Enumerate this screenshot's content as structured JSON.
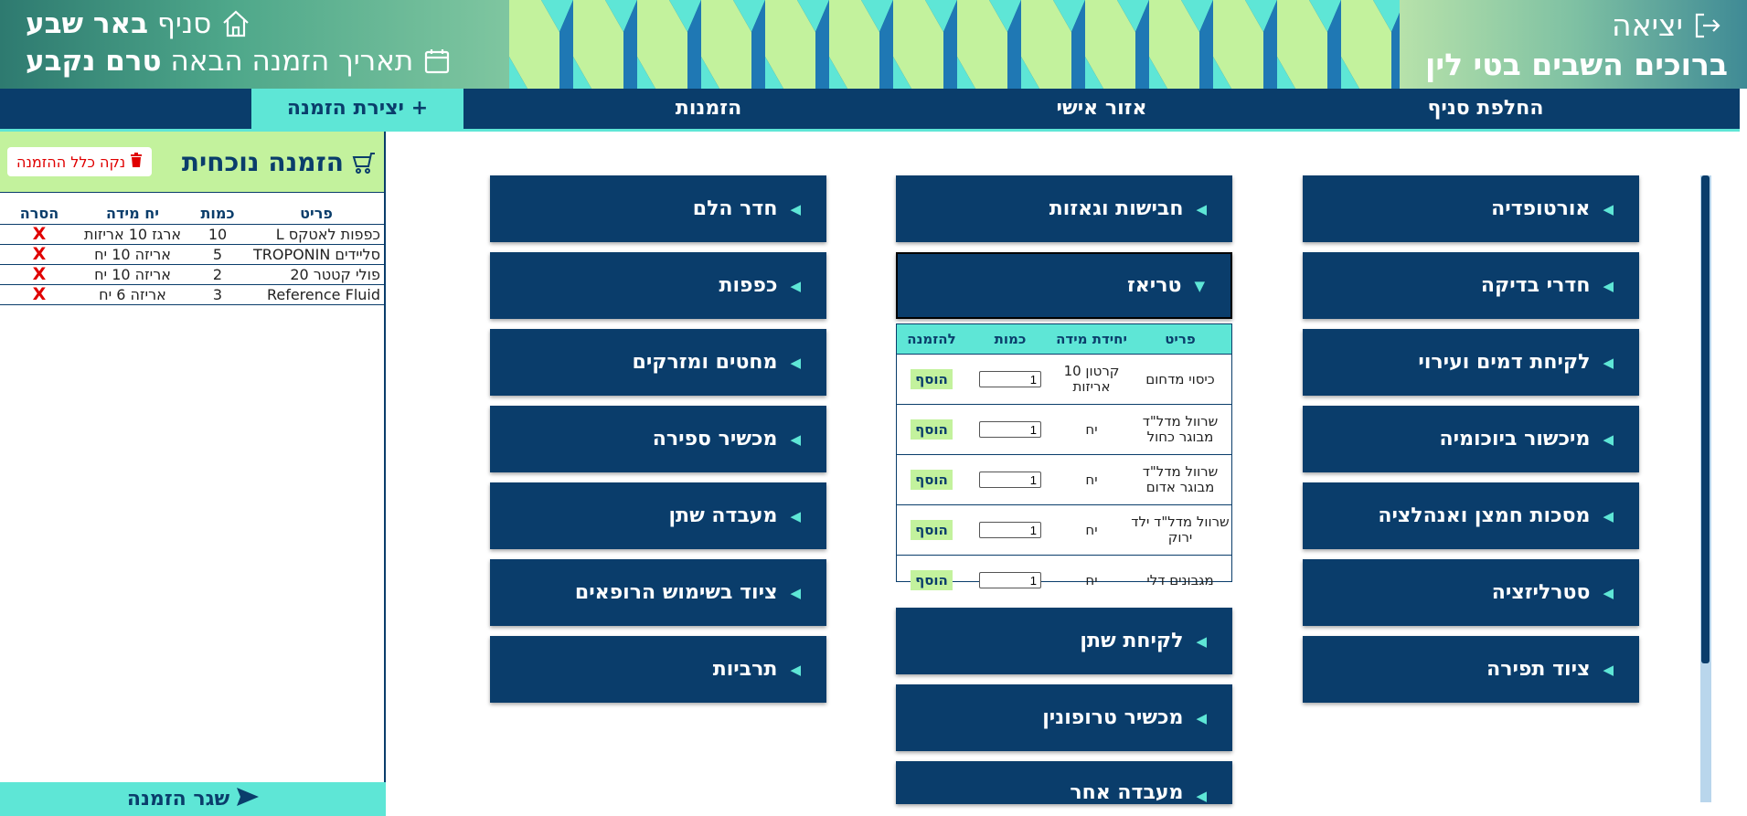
{
  "header": {
    "logout_label": "יציאה",
    "welcome_text": "ברוכים השבים בטי לין",
    "branch_prefix": "סניף",
    "branch_name": "באר שבע",
    "next_order_label": "תאריך הזמנה הבאה",
    "next_order_value": "טרם נקבע",
    "colors": {
      "navy": "#0a3d6b",
      "teal": "#5ee6d6",
      "lime": "#c3f29d"
    }
  },
  "nav": {
    "branch_switch": "החלפת סניף",
    "personal_area": "אזור אישי",
    "orders": "הזמנות",
    "create_order": "+ יצירת הזמנה"
  },
  "current_order": {
    "title": "הזמנה נוכחית",
    "clear_label": "נקה כלל ההזמנה",
    "columns": {
      "item": "פריט",
      "qty": "כמות",
      "unit": "יח מידה",
      "remove": "הסרה"
    },
    "rows": [
      {
        "item": "כפפות לאטקס L",
        "qty": "10",
        "unit": "ארגז 10 אריזות",
        "remove": "X"
      },
      {
        "item": "סליידים TROPONIN",
        "qty": "5",
        "unit": "אריזה 10 יח",
        "remove": "X"
      },
      {
        "item": "פולי קטטר 20",
        "qty": "2",
        "unit": "אריזה 10 יח",
        "remove": "X"
      },
      {
        "item": "Reference Fluid",
        "qty": "3",
        "unit": "אריזה 6 יח",
        "remove": "X"
      }
    ],
    "submit_label": "שגר הזמנה"
  },
  "categories": {
    "col_right": [
      "אורטופדיה",
      "חדרי בדיקה",
      "לקיחת דמים ועירוי",
      "מיכשור ביוכומיה",
      "מסכות חמצן ואנהלציה",
      "סטרליזציה",
      "ציוד תפירה"
    ],
    "col_mid": [
      "חבישות וגאזות",
      "טריאז",
      "לקיחת שתן",
      "מכשיר טרופונין",
      "מעבדה אחר"
    ],
    "col_left": [
      "חדר הלם",
      "כפפות",
      "מחטים ומזרקים",
      "מכשיר ספירה",
      "מעבדה שתן",
      "ציוד בשימוש הרופאים",
      "תרביות"
    ]
  },
  "triage": {
    "columns": {
      "item": "פריט",
      "unit": "יחידת מידה",
      "qty": "כמות",
      "add": "להזמנה"
    },
    "rows": [
      {
        "item": "כיסוי מדחום",
        "unit": "קרטון 10 אריזות",
        "qty": "1",
        "add": "הוסף"
      },
      {
        "item": "שרוול מדל\"ד מבוגר כחול",
        "unit": "יח",
        "qty": "1",
        "add": "הוסף"
      },
      {
        "item": "שרוול מדל\"ד מבוגר אדום",
        "unit": "יח",
        "qty": "1",
        "add": "הוסף"
      },
      {
        "item": "שרוול מדל\"ד ילד ירוק",
        "unit": "יח",
        "qty": "1",
        "add": "הוסף"
      },
      {
        "item": "מגבונים דלי",
        "unit": "יח",
        "qty": "1",
        "add": "הוסף"
      }
    ]
  },
  "icons": {
    "logout": "logout-icon",
    "home": "home-icon",
    "calendar": "calendar-icon",
    "cart": "cart-icon",
    "trash": "trash-icon",
    "send": "send-icon",
    "expand": "chevron-right-icon",
    "collapse": "chevron-down-icon"
  }
}
